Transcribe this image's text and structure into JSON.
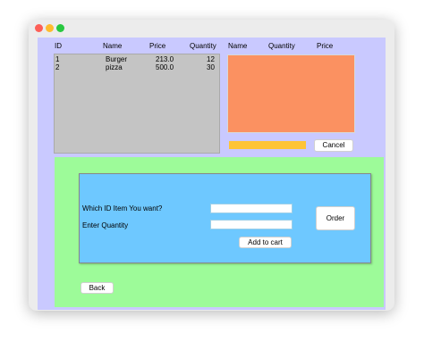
{
  "table_headers": {
    "id": "ID",
    "name": "Name",
    "price": "Price",
    "quantity": "Quantity"
  },
  "menu_items": [
    {
      "id": "1",
      "name": "Burger",
      "price": "213.0",
      "quantity": "12"
    },
    {
      "id": "2",
      "name": "pizza",
      "price": "500.0",
      "quantity": "30"
    }
  ],
  "cart_headers": {
    "name": "Name",
    "quantity": "Quantity",
    "price": "Price"
  },
  "cancel_label": "Cancel",
  "order_form": {
    "id_prompt": "Which ID Item You want?",
    "quantity_prompt": "Enter  Quantity",
    "id_value": "",
    "quantity_value": "",
    "add_to_cart_label": "Add to cart",
    "order_label": "Order"
  },
  "back_label": "Back",
  "colors": {
    "background": "#c9c9ff",
    "list_panel": "#c4c4c4",
    "cart_panel": "#fb9161",
    "progress_bar": "#fec436",
    "order_section": "#9dfb99",
    "order_form": "#6ec8ff"
  }
}
